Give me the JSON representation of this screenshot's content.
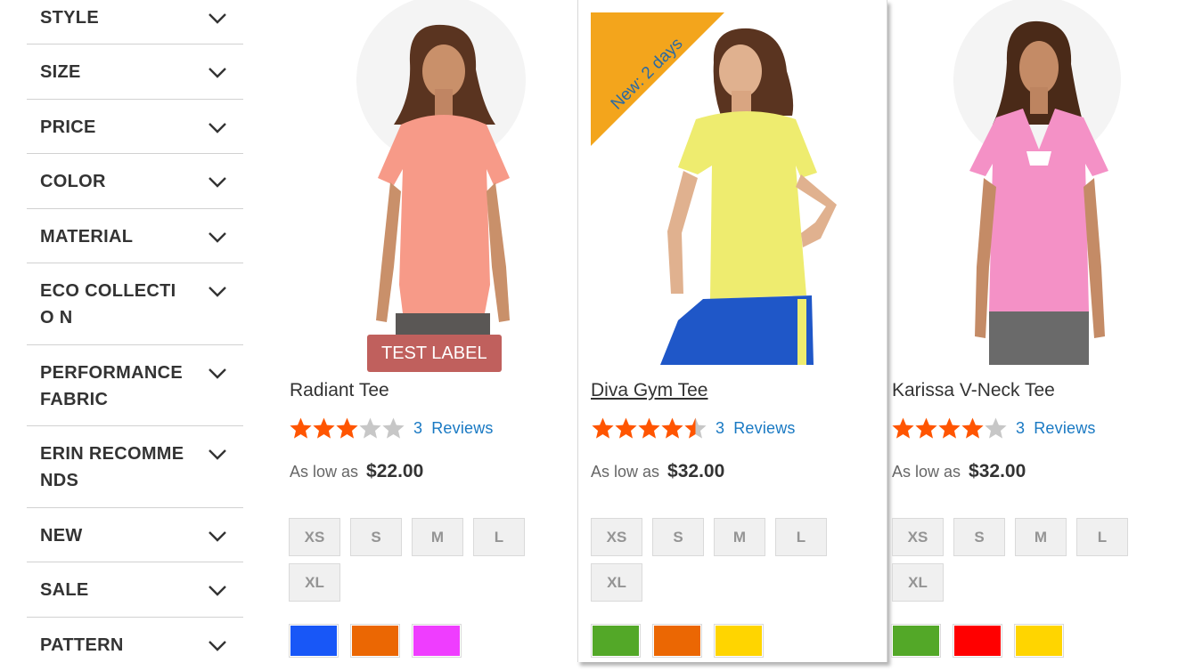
{
  "filters": [
    {
      "label": "STYLE"
    },
    {
      "label": "SIZE"
    },
    {
      "label": "PRICE"
    },
    {
      "label": "COLOR"
    },
    {
      "label": "MATERIAL"
    },
    {
      "label": "ECO COLLECTIO N"
    },
    {
      "label": "PERFORMANCE FABRIC"
    },
    {
      "label": "ERIN RECOMME NDS"
    },
    {
      "label": "NEW"
    },
    {
      "label": "SALE"
    },
    {
      "label": "PATTERN"
    }
  ],
  "products": [
    {
      "name": "Radiant Tee",
      "rating": 3,
      "review_count": "3",
      "review_word": "Reviews",
      "price_prefix": "As low as",
      "price": "$22.00",
      "label": "TEST LABEL",
      "sizes": [
        "XS",
        "S",
        "M",
        "L",
        "XL"
      ],
      "swatches": [
        "#1857f7",
        "#eb6703",
        "#ef3dff"
      ],
      "shirt_color": "#f79a88"
    },
    {
      "name": "Diva Gym Tee",
      "rating": 4.5,
      "review_count": "3",
      "review_word": "Reviews",
      "price_prefix": "As low as",
      "price": "$32.00",
      "ribbon": "New: 2 days",
      "sizes": [
        "XS",
        "S",
        "M",
        "L",
        "XL"
      ],
      "swatches": [
        "#53a828",
        "#eb6703",
        "#ffd500"
      ],
      "shirt_color": "#eeec6f"
    },
    {
      "name": "Karissa V-Neck Tee",
      "rating": 4,
      "review_count": "3",
      "review_word": "Reviews",
      "price_prefix": "As low as",
      "price": "$32.00",
      "sizes": [
        "XS",
        "S",
        "M",
        "L",
        "XL"
      ],
      "swatches": [
        "#53a828",
        "#ff0000",
        "#ffd500"
      ],
      "shirt_color": "#f491c6"
    }
  ],
  "colors": {
    "star_on": "#ff5501",
    "star_off": "#c7c7c7",
    "link": "#1979c3",
    "ribbon": "#f3a51c",
    "ribbon_text": "#2a6aa3"
  }
}
